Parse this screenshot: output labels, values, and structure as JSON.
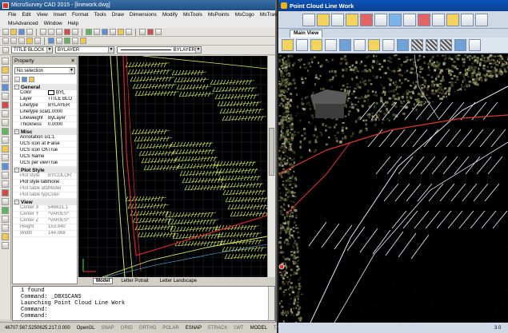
{
  "cad": {
    "title": "MicroSurvey CAD 2015 - [linework.dwg]",
    "menu1": [
      "File",
      "Edit",
      "View",
      "Insert",
      "Format",
      "Tools",
      "Draw",
      "Dimensions",
      "Modify",
      "MsTools",
      "MsPoints",
      "MsCogo",
      "MsTrav"
    ],
    "menu2": [
      "MsAdvanced",
      "Window",
      "Help"
    ],
    "layer_combo": "TITLE BLOCK",
    "linetype_combo": "BYLAYER",
    "lineweight_combo": "BYLAYER",
    "properties": {
      "title": "Property",
      "selection": "No selection",
      "sections": [
        {
          "name": "General",
          "rows": [
            {
              "k": "Color",
              "v": "BYL"
            },
            {
              "k": "Layer",
              "v": "TITLE BLO"
            },
            {
              "k": "Linetype",
              "v": "BYLAYER"
            },
            {
              "k": "Linetype scale",
              "v": "1.0000"
            },
            {
              "k": "Lineweight",
              "v": "ByLayer"
            },
            {
              "k": "Thickness",
              "v": "0.0000"
            }
          ]
        },
        {
          "name": "Misc",
          "rows": [
            {
              "k": "Annotation scale",
              "v": "1:1"
            },
            {
              "k": "UCS icon at origi",
              "v": "False"
            },
            {
              "k": "UCS icon ON",
              "v": "True"
            },
            {
              "k": "UCS Name",
              "v": ""
            },
            {
              "k": "UCS per viewpor",
              "v": "True"
            }
          ]
        },
        {
          "name": "Plot Style",
          "rows": [
            {
              "k": "Plot style",
              "v": "BYCOLOR"
            },
            {
              "k": "Plot style table",
              "v": "None"
            },
            {
              "k": "Plot table attach",
              "v": "Model"
            },
            {
              "k": "Plot table type",
              "v": "Color"
            }
          ]
        },
        {
          "name": "View",
          "rows": [
            {
              "k": "Center X",
              "v": "546631.1"
            },
            {
              "k": "Center Y",
              "v": "*VARIES*"
            },
            {
              "k": "Center Z",
              "v": "*VARIES*"
            },
            {
              "k": "Height",
              "v": "153.940"
            },
            {
              "k": "Width",
              "v": "144.068"
            }
          ]
        }
      ]
    },
    "layout_tabs": [
      "Model",
      "Letter Potrait",
      "Letter Landscape"
    ],
    "command_lines": [
      "1 found",
      "Command: _DBXSCANS",
      "Launching Point Cloud Line Work",
      "Command:",
      "Command:"
    ],
    "status_coords": "46707.567,5250625.217,0.000",
    "status_items": [
      "OpenGL",
      "SNAP",
      "GRID",
      "ORTHO",
      "POLAR",
      "ESNAP",
      "ETRACK",
      "LWT",
      "MODEL",
      "TABLET"
    ],
    "colors": {
      "title_bar": "#1e4f86",
      "canvas": "#000000",
      "linework": "#d6e46a",
      "boundary": "#d3262a",
      "grid": "#1f2f3a"
    }
  },
  "pc": {
    "title": "Point Cloud Line Work",
    "tab": "Main View",
    "status_text": "3.0",
    "colors": {
      "title_bar": "#0a3f91",
      "stripes": "#dfe8ef",
      "boundary": "#e03b2f"
    }
  }
}
